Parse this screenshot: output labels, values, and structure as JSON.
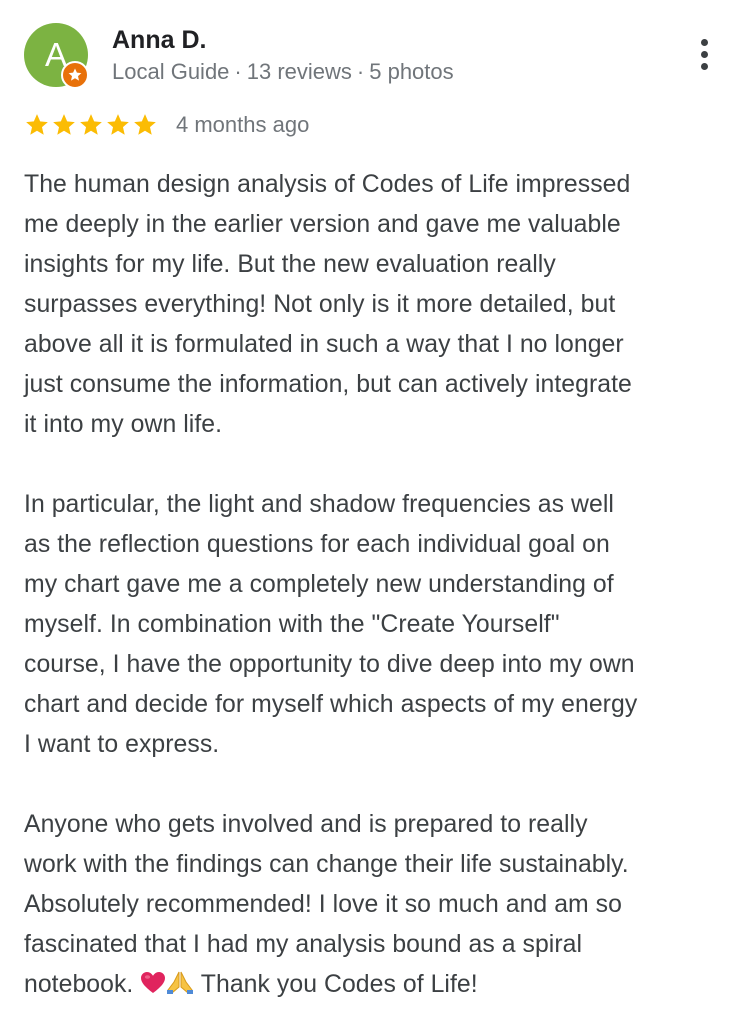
{
  "reviewer": {
    "initial": "A",
    "name": "Anna D.",
    "badge": "Local Guide",
    "reviews": "13 reviews",
    "photos": "5 photos",
    "separator": "·",
    "avatar_color": "#7cb342",
    "badge_color": "#e8710a",
    "badge_icon": "local-guide-star-icon"
  },
  "more_menu": {
    "icon": "more-vert-icon"
  },
  "rating": {
    "stars": 5,
    "max": 5,
    "star_color": "#fbbc04",
    "time": "4 months ago"
  },
  "review": {
    "paragraphs": [
      {
        "lines": [
          "The human design analysis of Codes of Life impressed",
          "me deeply in the earlier version and gave me valuable",
          "insights for my life. But the new evaluation really",
          "surpasses everything! Not only is it more detailed, but",
          "above all it is formulated in such a way that I no longer",
          "just consume the information, but can actively integrate",
          "it into my own life."
        ]
      },
      {
        "lines": [
          "In particular, the light and shadow frequencies as well",
          "as the reflection questions for each individual goal on",
          "my chart gave me a completely new understanding of",
          "myself. In combination with the \"Create Yourself\"",
          "course, I have the opportunity to dive deep into my own",
          "chart and decide for myself which aspects of my energy",
          "I want to express."
        ]
      },
      {
        "lines": [
          "Anyone who gets involved and is prepared to really",
          "work with the findings can change their life sustainably.",
          "Absolutely recommended! I love it so much and am so",
          "fascinated that I had my analysis bound as a spiral"
        ],
        "last_line": {
          "start": "notebook. ",
          "heart": "❤️",
          "hands": "🙏",
          "end": " Thank you Codes of Life!"
        }
      }
    ]
  }
}
